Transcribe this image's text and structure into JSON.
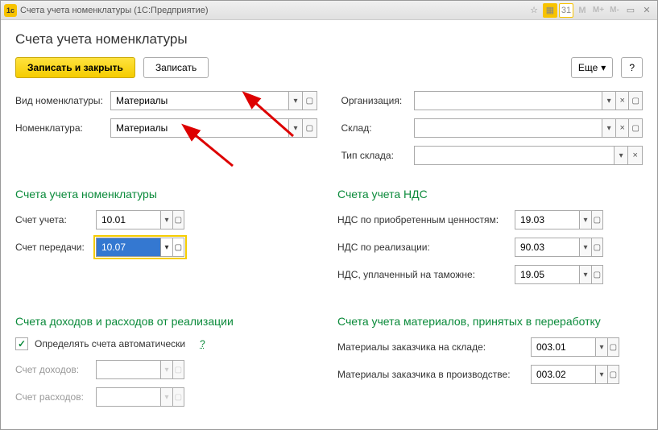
{
  "titlebar": {
    "text": "Счета учета номенклатуры  (1С:Предприятие)",
    "cal_day": "31"
  },
  "header": {
    "title": "Счета учета номенклатуры"
  },
  "toolbar": {
    "save_close": "Записать и закрыть",
    "save": "Записать",
    "more": "Еще",
    "q": "?"
  },
  "top_fields": {
    "type_label": "Вид номенклатуры:",
    "type_value": "Материалы",
    "nomen_label": "Номенклатура:",
    "nomen_value": "Материалы",
    "org_label": "Организация:",
    "org_value": "",
    "wh_label": "Склад:",
    "wh_value": "",
    "whtype_label": "Тип склада:",
    "whtype_value": ""
  },
  "acct_section": {
    "title": "Счета учета номенклатуры",
    "acct_label": "Счет учета:",
    "acct_value": "10.01",
    "transfer_label": "Счет передачи:",
    "transfer_value": "10.07"
  },
  "vat_section": {
    "title": "Счета учета НДС",
    "purch_label": "НДС по приобретенным ценностям:",
    "purch_value": "19.03",
    "real_label": "НДС по реализации:",
    "real_value": "90.03",
    "customs_label": "НДС, уплаченный на таможне:",
    "customs_value": "19.05"
  },
  "income_section": {
    "title": "Счета доходов и расходов от реализации",
    "auto_label": "Определять счета автоматически",
    "income_label": "Счет доходов:",
    "expense_label": "Счет расходов:"
  },
  "mat_section": {
    "title": "Счета учета материалов, принятых в переработку",
    "wh_label": "Материалы заказчика на складе:",
    "wh_value": "003.01",
    "prod_label": "Материалы заказчика в производстве:",
    "prod_value": "003.02"
  }
}
